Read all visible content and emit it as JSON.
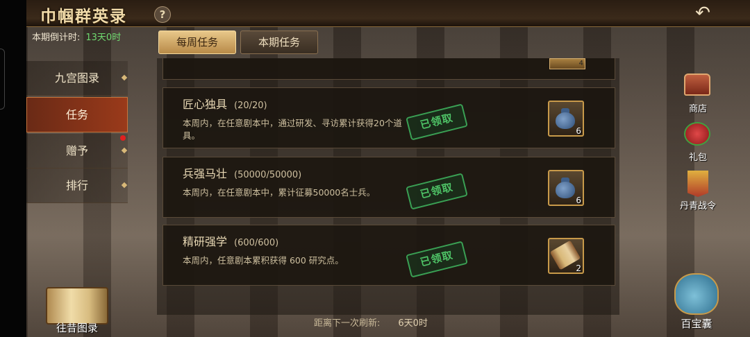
{
  "header": {
    "title": "巾帼群英录",
    "help_symbol": "?",
    "back_symbol": "↶"
  },
  "countdown": {
    "label": "本期倒计时:",
    "value": "13天0时"
  },
  "tabs": [
    {
      "label": "每周任务"
    },
    {
      "label": "本期任务"
    }
  ],
  "sidebar": {
    "items": [
      {
        "label": "九宫图录"
      },
      {
        "label": "任务"
      },
      {
        "label": "赠予"
      },
      {
        "label": "排行"
      }
    ]
  },
  "partial_card": {
    "count": "4"
  },
  "tasks": [
    {
      "title": "匠心独具",
      "progress": "(20/20)",
      "desc": "本周内，在任意剧本中，通过研发、寻访累计获得20个道具。",
      "status": "已领取",
      "reward_icon": "bag-icon",
      "reward_count": "6"
    },
    {
      "title": "兵强马壮",
      "progress": "(50000/50000)",
      "desc": "本周内，在任意剧本中，累计征募50000名士兵。",
      "status": "已领取",
      "reward_icon": "bag-icon",
      "reward_count": "6"
    },
    {
      "title": "精研强学",
      "progress": "(600/600)",
      "desc": "本周内，任意剧本累积获得 600 研究点。",
      "status": "已领取",
      "reward_icon": "scroll-icon",
      "reward_count": "2"
    }
  ],
  "refresh": {
    "label": "距离下一次刷新:",
    "value": "6天0时"
  },
  "right_menu": {
    "shop": "商店",
    "gift": "礼包",
    "pass": "丹青战令",
    "treasure": "百宝囊"
  },
  "bottom_left": {
    "label": "往昔图录"
  },
  "colors": {
    "accent_gold": "#e8c88a",
    "countdown_green": "#6fd86f",
    "stamp_green": "#4ec266",
    "active_tab_red": "#9a3a1a"
  }
}
